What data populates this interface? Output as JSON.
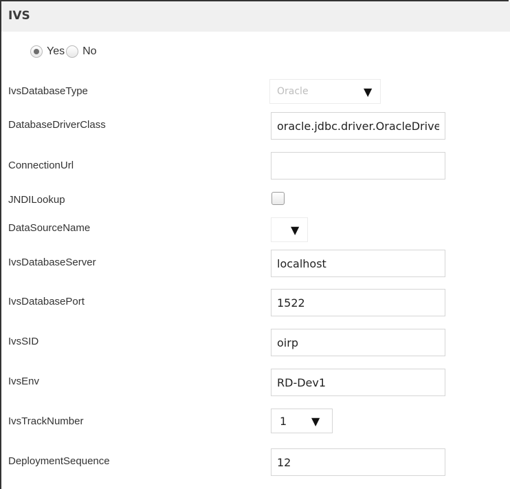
{
  "panel": {
    "title": "IVS"
  },
  "toggle": {
    "yes_label": "Yes",
    "no_label": "No",
    "selected": "Yes"
  },
  "fields": {
    "db_type": {
      "label": "IvsDatabaseType",
      "value": "Oracle"
    },
    "driver_class": {
      "label": "DatabaseDriverClass",
      "value": "oracle.jdbc.driver.OracleDriver"
    },
    "connection_url": {
      "label": "ConnectionUrl",
      "value": ""
    },
    "jndi_lookup": {
      "label": "JNDILookup",
      "checked": false
    },
    "datasource_name": {
      "label": "DataSourceName",
      "value": ""
    },
    "db_server": {
      "label": "IvsDatabaseServer",
      "value": "localhost"
    },
    "db_port": {
      "label": "IvsDatabasePort",
      "value": "1522"
    },
    "sid": {
      "label": "IvsSID",
      "value": "oirp"
    },
    "env": {
      "label": "IvsEnv",
      "value": "RD-Dev1"
    },
    "track_number": {
      "label": "IvsTrackNumber",
      "value": "1"
    },
    "deployment_sequence": {
      "label": "DeploymentSequence",
      "value": "12"
    }
  },
  "icons": {
    "dropdown_caret": "▼"
  }
}
